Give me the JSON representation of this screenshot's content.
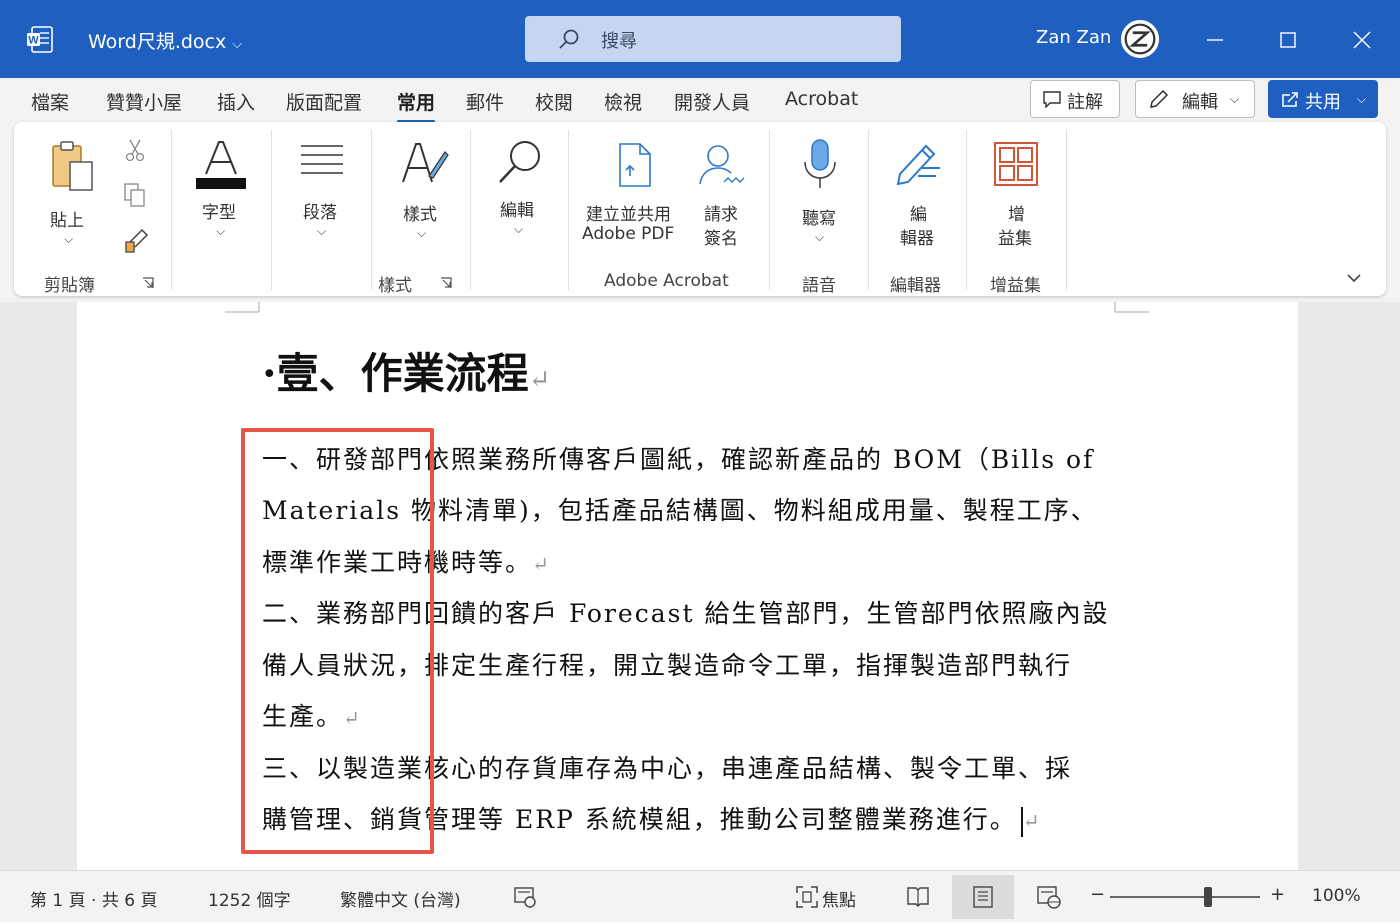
{
  "titlebar": {
    "doc_title": "Word尺規.docx",
    "title_chevron": "⌵",
    "search_placeholder": "搜尋",
    "user_name": "Zan Zan",
    "accent": "#1f5fbf"
  },
  "tabs": [
    "檔案",
    "贊贊小屋",
    "插入",
    "版面配置",
    "常用",
    "郵件",
    "校閱",
    "檢視",
    "開發人員",
    "Acrobat"
  ],
  "active_tab": "常用",
  "top_buttons": {
    "comment": "註解",
    "edit": "編輯",
    "share": "共用"
  },
  "ribbon": {
    "paste": "貼上",
    "clipboard_group": "剪貼簿",
    "font": "字型",
    "paragraph": "段落",
    "styles": "樣式",
    "styles_group": "樣式",
    "editing": "編輯",
    "create_share_pdf_1": "建立並共用",
    "create_share_pdf_2": "Adobe PDF",
    "request_sign_1": "請求",
    "request_sign_2": "簽名",
    "acrobat_group": "Adobe Acrobat",
    "dictate": "聽寫",
    "voice_group": "語音",
    "editor_1": "編",
    "editor_2": "輯器",
    "editor_group": "編輯器",
    "addins_1": "增",
    "addins_2": "益集",
    "addins_group": "增益集"
  },
  "document": {
    "heading": "·壹、作業流程",
    "lines": [
      "一、研發部門依照業務所傳客戶圖紙，確認新產品的 BOM（Bills of",
      "Materials 物料清單)，包括產品結構圖、物料組成用量、製程工序、",
      "標準作業工時機時等。",
      "二、業務部門回饋的客戶 Forecast 給生管部門，生管部門依照廠內設",
      "備人員狀況，排定生產行程，開立製造命令工單，指揮製造部門執行",
      "生產。",
      "三、以製造業核心的存貨庫存為中心，串連產品結構、製令工單、採",
      "購管理、銷貨管理等 ERP 系統模組，推動公司整體業務進行。"
    ],
    "paragraph_mark": "↵",
    "highlight_color": "#e3574a"
  },
  "statusbar": {
    "page_info": "第 1 頁 · 共 6 頁",
    "word_count": "1252 個字",
    "language": "繁體中文 (台灣)",
    "focus": "焦點",
    "zoom_minus": "−",
    "zoom_plus": "+",
    "zoom_level": "100%",
    "zoom_fraction": 0.5
  }
}
